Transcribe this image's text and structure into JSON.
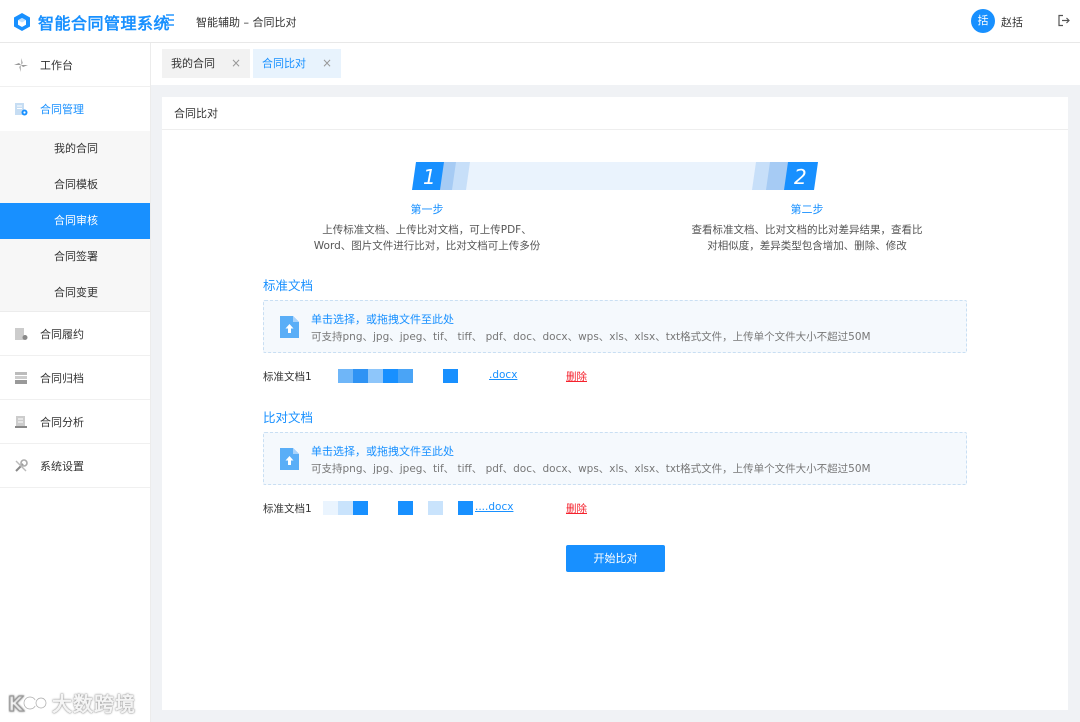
{
  "app": {
    "title": "智能合同管理系统"
  },
  "header": {
    "breadcrumb": "智能辅助 – 合同比对",
    "user_avatar": "括",
    "user_name": "赵括"
  },
  "sidebar": {
    "items": [
      {
        "label": "工作台",
        "icon": "workbench-icon"
      },
      {
        "label": "合同管理",
        "icon": "contract-manage-icon"
      },
      {
        "label": "合同履约",
        "icon": "fulfillment-icon"
      },
      {
        "label": "合同归档",
        "icon": "archive-icon"
      },
      {
        "label": "合同分析",
        "icon": "analysis-icon"
      },
      {
        "label": "系统设置",
        "icon": "settings-icon"
      }
    ],
    "submenu": [
      {
        "label": "我的合同"
      },
      {
        "label": "合同模板"
      },
      {
        "label": "合同审核"
      },
      {
        "label": "合同签署"
      },
      {
        "label": "合同变更"
      }
    ]
  },
  "tabs": [
    {
      "label": "我的合同",
      "close": "×"
    },
    {
      "label": "合同比对",
      "close": "×"
    }
  ],
  "card": {
    "title": "合同比对",
    "steps": [
      {
        "number": "1",
        "title": "第一步",
        "desc_line1": "上传标准文档、上传比对文档，可上传PDF、",
        "desc_line2": "Word、图片文件进行比对，比对文档可上传多份"
      },
      {
        "number": "2",
        "title": "第二步",
        "desc_line1": "查看标准文档、比对文档的比对差异结果，查看比",
        "desc_line2": "对相似度，差异类型包含增加、删除、修改"
      }
    ],
    "standard": {
      "title": "标准文档",
      "upload_title": "单击选择，或拖拽文件至此处",
      "upload_hint": "可支持png、jpg、jpeg、tif、 tiff、 pdf、doc、docx、wps、xls、xlsx、txt格式文件，上传单个文件大小不超过50M",
      "file_label": "标准文档1",
      "file_ext": ".docx",
      "delete": "删除"
    },
    "compare": {
      "title": "比对文档",
      "upload_title": "单击选择，或拖拽文件至此处",
      "upload_hint": "可支持png、jpg、jpeg、tif、 tiff、 pdf、doc、docx、wps、xls、xlsx、txt格式文件，上传单个文件大小不超过50M",
      "file_label": "标准文档1",
      "file_ext": "....docx",
      "delete": "删除"
    },
    "start_button": "开始比对"
  },
  "watermark": "大数跨境",
  "colors": {
    "accent": "#1890ff",
    "danger": "#f5222d"
  }
}
